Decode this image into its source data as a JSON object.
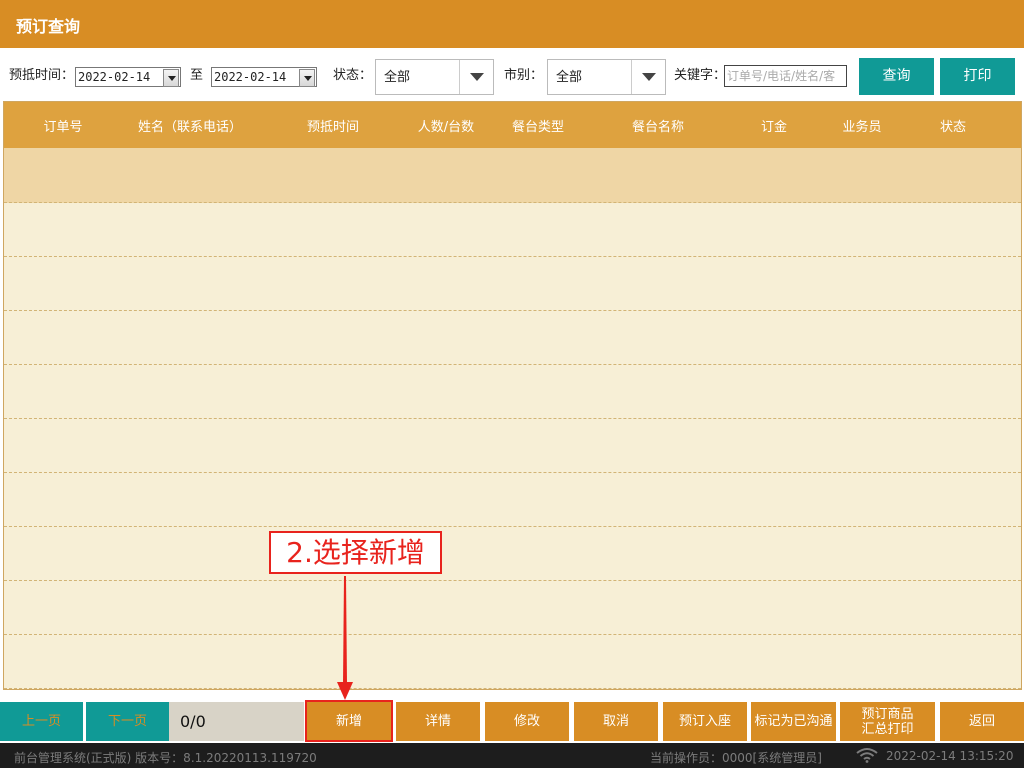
{
  "window": {
    "title": "预订查询"
  },
  "filters": {
    "date_label": "预抵时间：",
    "date_from": "2022-02-14",
    "to_label": "至",
    "date_to": "2022-02-14",
    "status_label": "状态：",
    "status_value": "全部",
    "market_label": "市别：",
    "market_value": "全部",
    "keyword_label": "关键字：",
    "keyword_placeholder": "订单号/电话/姓名/客",
    "query_button": "查询",
    "print_button": "打印"
  },
  "table": {
    "columns": [
      "订单号",
      "姓名（联系电话）",
      "预抵时间",
      "人数/台数",
      "餐台类型",
      "餐台名称",
      "订金",
      "业务员",
      "状态"
    ],
    "rows": []
  },
  "toolbar": {
    "prev_page": "上一页",
    "next_page": "下一页",
    "page_indicator": "0/0",
    "add": "新增",
    "details": "详情",
    "modify": "修改",
    "cancel": "取消",
    "checkin": "预订入座",
    "mark_contacted": "标记为已沟通",
    "summary_print_line1": "预订商品",
    "summary_print_line2": "汇总打印",
    "back": "返回"
  },
  "status_bar": {
    "system_info": "前台管理系统(正式版) 版本号：8.1.20220113.119720",
    "operator": "当前操作员：0000[系统管理员]",
    "datetime": "2022-02-14 13:15:20"
  },
  "annotation": {
    "text": "2.选择新增"
  },
  "colors": {
    "brand_orange": "#d88d24",
    "header_gold": "#dea23f",
    "teal": "#109a96",
    "row_bg": "#f7efd6",
    "selected_row": "#efd6a5",
    "annotation_red": "#e8231d"
  }
}
